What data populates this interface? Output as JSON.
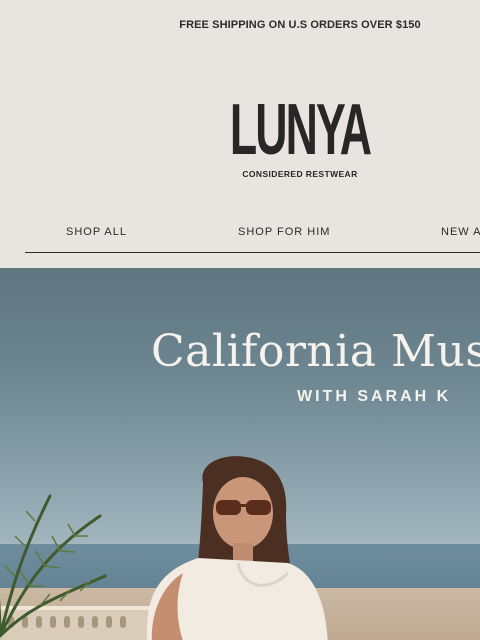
{
  "announcement": {
    "text": "FREE SHIPPING ON U.S ORDERS OVER $150"
  },
  "brand": {
    "name": "LUNYA",
    "tagline": "CONSIDERED RESTWEAR"
  },
  "nav": {
    "items": [
      {
        "label": "SHOP ALL"
      },
      {
        "label": "SHOP FOR HIM"
      },
      {
        "label": "NEW A"
      }
    ]
  },
  "hero": {
    "title": "California Mus",
    "subtitle": "WITH SARAH K"
  },
  "colors": {
    "background": "#e8e4e0",
    "text": "#2b2b2b",
    "hero_text": "#f6f2ec"
  },
  "icons": {
    "logo": "lunya-wordmark"
  }
}
